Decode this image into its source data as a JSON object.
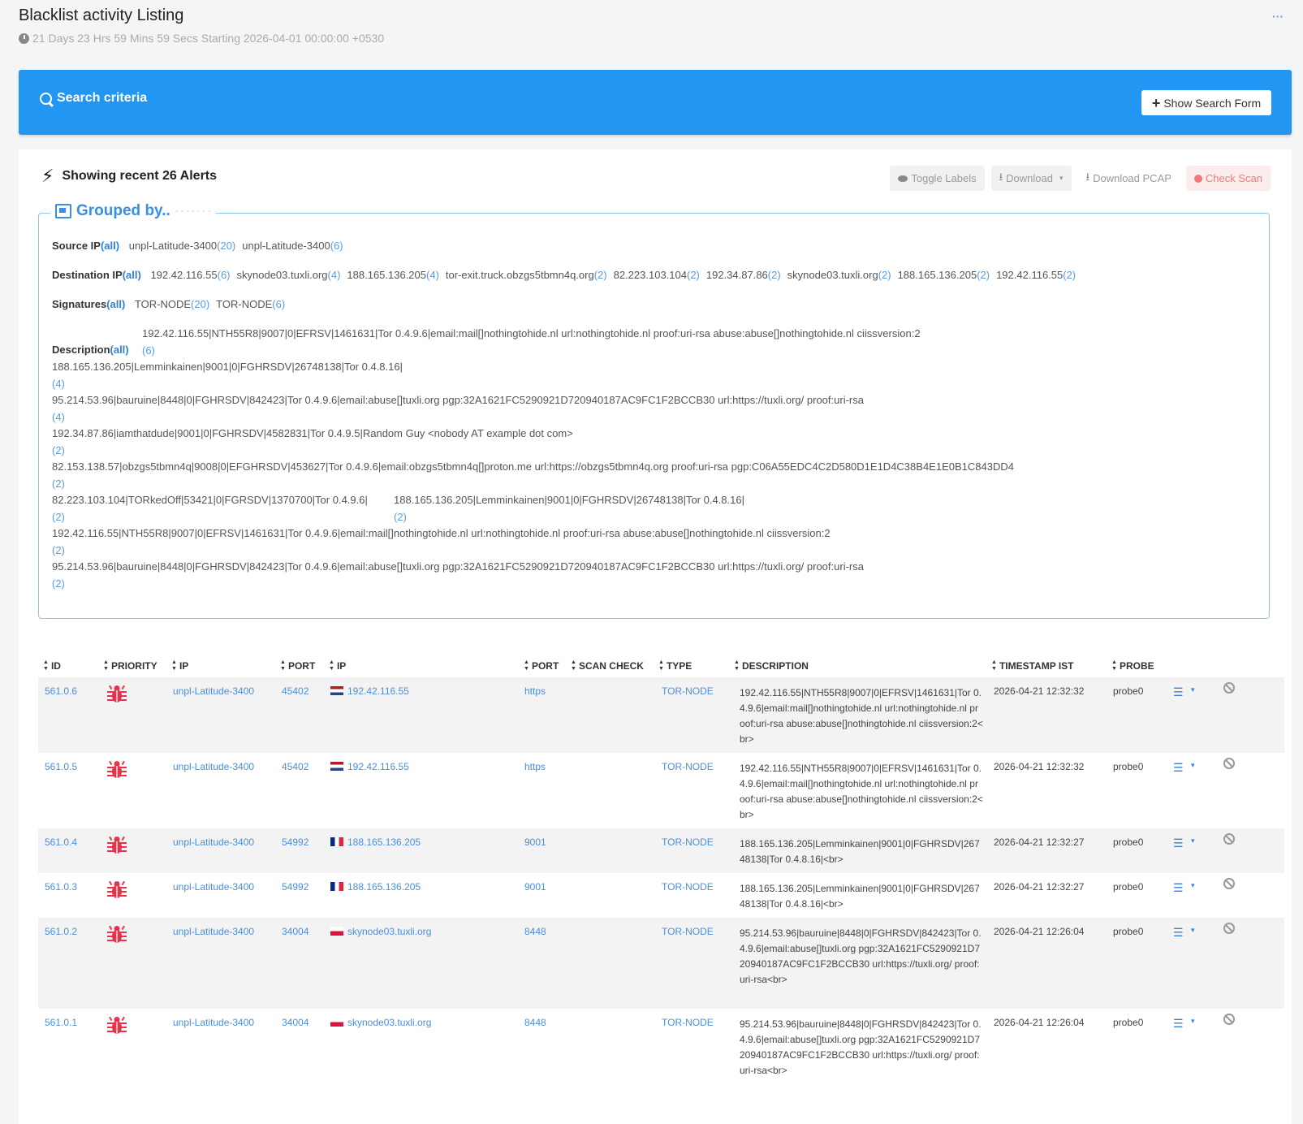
{
  "page": {
    "title": "Blacklist activity Listing",
    "subtitle": "21 Days 23 Hrs 59 Mins 59 Secs Starting 2026-04-01 00:00:00 +0530",
    "corner_menu": "···"
  },
  "search": {
    "title": "Search criteria",
    "show_form_label": "Show Search Form"
  },
  "alerts": {
    "title": "Showing recent 26 Alerts",
    "toolbar": {
      "toggle_labels": "Toggle Labels",
      "download": "Download",
      "download_pcap": "Download PCAP",
      "check_scan": "Check Scan"
    }
  },
  "grouped": {
    "title": "Grouped by..",
    "all_label": "(all)",
    "source_ip_label": "Source IP",
    "source_ip": [
      {
        "name": "unpl-Latitude-3400",
        "count": "(20)"
      },
      {
        "name": "unpl-Latitude-3400",
        "count": "(6)"
      }
    ],
    "dest_ip_label": "Destination IP",
    "dest_ip": [
      {
        "name": "192.42.116.55",
        "count": "(6)"
      },
      {
        "name": "skynode03.tuxli.org",
        "count": "(4)"
      },
      {
        "name": "188.165.136.205",
        "count": "(4)"
      },
      {
        "name": "tor-exit.truck.obzgs5tbmn4q.org",
        "count": "(2)"
      },
      {
        "name": "82.223.103.104",
        "count": "(2)"
      },
      {
        "name": "192.34.87.86",
        "count": "(2)"
      },
      {
        "name": "skynode03.tuxli.org",
        "count": "(2)"
      },
      {
        "name": "188.165.136.205",
        "count": "(2)"
      },
      {
        "name": "192.42.116.55",
        "count": "(2)"
      }
    ],
    "signatures_label": "Signatures",
    "signatures": [
      {
        "name": "TOR-NODE",
        "count": "(20)"
      },
      {
        "name": "TOR-NODE",
        "count": "(6)"
      }
    ],
    "description_label": "Description",
    "descriptions": [
      {
        "text": "192.42.116.55|NTH55R8|9007|0|EFRSV|1461631|Tor 0.4.9.6|email:mail[]nothingtohide.nl url:nothingtohide.nl proof:uri-rsa abuse:abuse[]nothingtohide.nl ciissversion:2",
        "count": "(6)"
      },
      {
        "text": "188.165.136.205|Lemminkainen|9001|0|FGHRSDV|26748138|Tor 0.4.8.16|",
        "count": "(4)"
      },
      {
        "text": "95.214.53.96|bauruine|8448|0|FGHRSDV|842423|Tor 0.4.9.6|email:abuse[]tuxli.org pgp:32A1621FC5290921D720940187AC9FC1F2BCCB30 url:https://tuxli.org/ proof:uri-rsa",
        "count": "(4)"
      },
      {
        "text": "192.34.87.86|iamthatdude|9001|0|FGHRSDV|4582831|Tor 0.4.9.5|Random Guy <nobody AT example dot com>",
        "count": "(2)"
      },
      {
        "text": "82.153.138.57|obzgs5tbmn4q|9008|0|EFGHRSDV|453627|Tor 0.4.9.6|email:obzgs5tbmn4q[]proton.me url:https://obzgs5tbmn4q.org proof:uri-rsa pgp:C06A55EDC4C2D580D1E1D4C38B4E1E0B1C843DD4",
        "count": "(2)"
      },
      {
        "text": "82.223.103.104|TORkedOff|53421|0|FGRSDV|1370700|Tor 0.4.9.6|",
        "count": "(2)"
      },
      {
        "text": "188.165.136.205|Lemminkainen|9001|0|FGHRSDV|26748138|Tor 0.4.8.16|",
        "count": "(2)"
      },
      {
        "text": "192.42.116.55|NTH55R8|9007|0|EFRSV|1461631|Tor 0.4.9.6|email:mail[]nothingtohide.nl url:nothingtohide.nl proof:uri-rsa abuse:abuse[]nothingtohide.nl ciissversion:2",
        "count": "(2)"
      },
      {
        "text": "95.214.53.96|bauruine|8448|0|FGHRSDV|842423|Tor 0.4.9.6|email:abuse[]tuxli.org pgp:32A1621FC5290921D720940187AC9FC1F2BCCB30 url:https://tuxli.org/ proof:uri-rsa",
        "count": "(2)"
      }
    ]
  },
  "table": {
    "headers": [
      "ID",
      "PRIORITY",
      "IP",
      "PORT",
      "IP",
      "PORT",
      "SCAN CHECK",
      "TYPE",
      "DESCRIPTION",
      "TIMESTAMP IST",
      "PROBE"
    ],
    "rows": [
      {
        "id": "561.0.6",
        "src_ip": "unpl-Latitude-3400",
        "src_port": "45402",
        "flag": "nl",
        "dst_ip": "192.42.116.55",
        "dst_port": "https",
        "type": "TOR-NODE",
        "description": "192.42.116.55|NTH55R8|9007|0|EFRSV|1461631|Tor 0.4.9.6|email:mail[]nothingtohide.nl url:nothingtohide.nl proof:uri-rsa abuse:abuse[]nothingtohide.nl ciissversion:2<br>",
        "timestamp": "2026-04-21 12:32:32",
        "probe": "probe0"
      },
      {
        "id": "561.0.5",
        "src_ip": "unpl-Latitude-3400",
        "src_port": "45402",
        "flag": "nl",
        "dst_ip": "192.42.116.55",
        "dst_port": "https",
        "type": "TOR-NODE",
        "description": "192.42.116.55|NTH55R8|9007|0|EFRSV|1461631|Tor 0.4.9.6|email:mail[]nothingtohide.nl url:nothingtohide.nl proof:uri-rsa abuse:abuse[]nothingtohide.nl ciissversion:2<br>",
        "timestamp": "2026-04-21 12:32:32",
        "probe": "probe0"
      },
      {
        "id": "561.0.4",
        "src_ip": "unpl-Latitude-3400",
        "src_port": "54992",
        "flag": "fr",
        "dst_ip": "188.165.136.205",
        "dst_port": "9001",
        "type": "TOR-NODE",
        "description": "188.165.136.205|Lemminkainen|9001|0|FGHRSDV|26748138|Tor 0.4.8.16|<br>",
        "timestamp": "2026-04-21 12:32:27",
        "probe": "probe0"
      },
      {
        "id": "561.0.3",
        "src_ip": "unpl-Latitude-3400",
        "src_port": "54992",
        "flag": "fr",
        "dst_ip": "188.165.136.205",
        "dst_port": "9001",
        "type": "TOR-NODE",
        "description": "188.165.136.205|Lemminkainen|9001|0|FGHRSDV|26748138|Tor 0.4.8.16|<br>",
        "timestamp": "2026-04-21 12:32:27",
        "probe": "probe0"
      },
      {
        "id": "561.0.2",
        "src_ip": "unpl-Latitude-3400",
        "src_port": "34004",
        "flag": "pl",
        "dst_ip": "skynode03.tuxli.org",
        "dst_port": "8448",
        "type": "TOR-NODE",
        "description": "95.214.53.96|bauruine|8448|0|FGHRSDV|842423|Tor 0.4.9.6|email:abuse[]tuxli.org pgp:32A1621FC5290921D720940187AC9FC1F2BCCB30 url:https://tuxli.org/ proof:uri-rsa<br>",
        "timestamp": "2026-04-21 12:26:04",
        "probe": "probe0"
      },
      {
        "id": "561.0.1",
        "src_ip": "unpl-Latitude-3400",
        "src_port": "34004",
        "flag": "pl",
        "dst_ip": "skynode03.tuxli.org",
        "dst_port": "8448",
        "type": "TOR-NODE",
        "description": "95.214.53.96|bauruine|8448|0|FGHRSDV|842423|Tor 0.4.9.6|email:abuse[]tuxli.org pgp:32A1621FC5290921D720940187AC9FC1F2BCCB30 url:https://tuxli.org/ proof:uri-rsa<br>",
        "timestamp": "2026-04-21 12:26:04",
        "probe": "probe0"
      }
    ]
  },
  "colors": {
    "accent": "#2196f3",
    "link": "#4a8fd8",
    "priority_bug": "#e8334a"
  },
  "icons": [
    "clock-icon",
    "search-icon",
    "plus-icon",
    "bolt-icon",
    "eye-icon",
    "download-icon",
    "bug-icon",
    "grouped-icon",
    "menu-icon",
    "ban-icon",
    "sort-icon"
  ]
}
